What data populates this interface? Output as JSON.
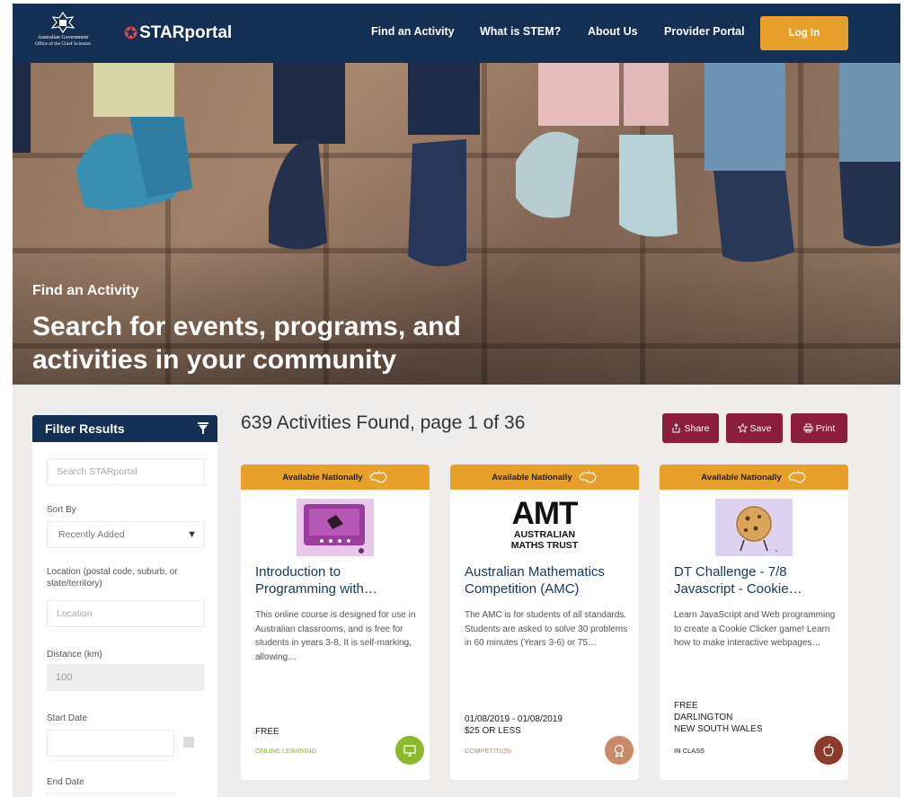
{
  "header": {
    "gov_line1": "Australian Government",
    "gov_line2": "Office of the Chief Scientist",
    "brand": "STARportal",
    "nav": [
      {
        "label": "Find an Activity"
      },
      {
        "label": "What is STEM?"
      },
      {
        "label": "About Us"
      },
      {
        "label": "Provider Portal"
      }
    ],
    "login_label": "Log In"
  },
  "hero": {
    "eyebrow": "Find an Activity",
    "title": "Search for events, programs, and activities in your community"
  },
  "filter": {
    "heading": "Filter Results",
    "search_placeholder": "Search STARportal",
    "sort_label": "Sort By",
    "sort_value": "Recently Added",
    "location_label": "Location (postal code, suburb, or state/territory)",
    "location_placeholder": "Location",
    "distance_label": "Distance (km)",
    "distance_value": "100",
    "start_label": "Start Date",
    "end_label": "End Date"
  },
  "results": {
    "summary": "639 Activities Found, page 1 of 36",
    "share_label": "Share",
    "save_label": "Save",
    "print_label": "Print"
  },
  "cards": [
    {
      "banner": "Available Nationally",
      "title": "Introduction to Programming with…",
      "description": "This online course is designed for use in Australian classrooms, and is free for students in years 3-8. It is self-marking, allowing…",
      "meta1": "FREE",
      "meta2": "",
      "meta3": "",
      "category": "ONLINE LEARNING",
      "category_color": "#8cb82b",
      "badge_color": "#8cb82b",
      "badge_icon": "monitor-icon"
    },
    {
      "banner": "Available Nationally",
      "title": "Australian Mathematics Competition (AMC)",
      "logo_text": "AMT",
      "logo_sub1": "AUSTRALIAN",
      "logo_sub2": "MATHS TRUST",
      "description": "The AMC is for students of all standards. Students are asked to solve 30 problems in 60 minutes  (Years 3-6) or 75…",
      "meta1": "01/08/2019 - 01/08/2019",
      "meta2": "$25 OR LESS",
      "meta3": "",
      "category": "COMPETITION",
      "category_color": "#c98a6a",
      "badge_color": "#c98a6a",
      "badge_icon": "medal-icon"
    },
    {
      "banner": "Available Nationally",
      "title": "DT Challenge - 7/8 Javascript - Cookie…",
      "description": "Learn JavaScript and Web programming to create a Cookie Clicker game! Learn how to make interactive webpages…",
      "meta1": "FREE",
      "meta2": "DARLINGTON",
      "meta3": "NEW SOUTH WALES",
      "category": "IN CLASS",
      "category_color": "#222222",
      "badge_color": "#8b3a2e",
      "badge_icon": "apple-icon"
    }
  ],
  "colors": {
    "navy": "#132f54",
    "orange": "#e6a02b",
    "maroon": "#8b1d3d"
  }
}
